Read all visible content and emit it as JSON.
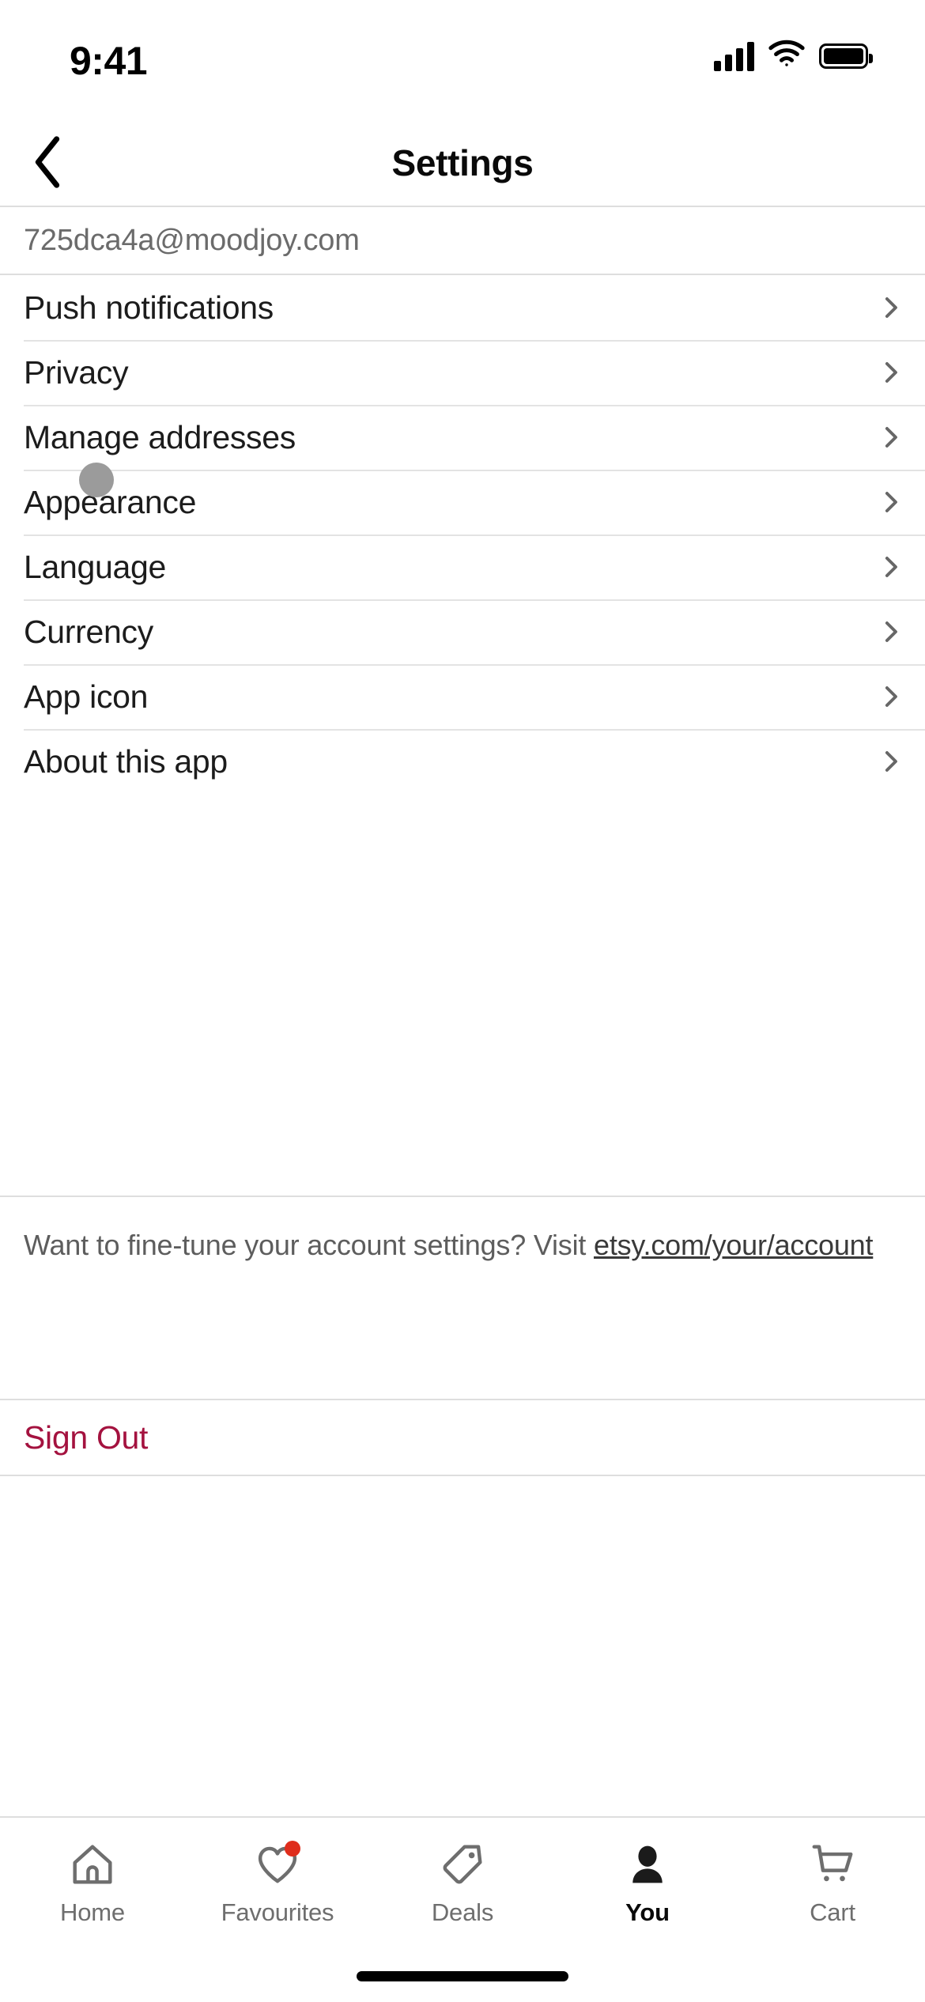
{
  "status_bar": {
    "time": "9:41",
    "icons": [
      "cellular-signal-icon",
      "wifi-icon",
      "battery-icon"
    ]
  },
  "nav_bar": {
    "back_icon": "chevron-left-icon",
    "title": "Settings"
  },
  "account": {
    "email": "725dca4a@moodjoy.com"
  },
  "settings_list": {
    "chevron_icon": "chevron-right-icon",
    "items": [
      {
        "label": "Push notifications"
      },
      {
        "label": "Privacy"
      },
      {
        "label": "Manage addresses"
      },
      {
        "label": "Appearance"
      },
      {
        "label": "Language"
      },
      {
        "label": "Currency"
      },
      {
        "label": "App icon"
      },
      {
        "label": "About this app"
      }
    ]
  },
  "footer_note": {
    "text": "Want to fine-tune your account settings? Visit ",
    "link_text": "etsy.com/your/account"
  },
  "sign_out": {
    "label": "Sign Out",
    "color": "#a4123f"
  },
  "touch_indicator": {
    "color": "#9b9b9b"
  },
  "tab_bar": {
    "tabs": [
      {
        "label": "Home",
        "icon": "home-icon",
        "active": false,
        "badge": false
      },
      {
        "label": "Favourites",
        "icon": "heart-icon",
        "active": false,
        "badge": true
      },
      {
        "label": "Deals",
        "icon": "tag-icon",
        "active": false,
        "badge": false
      },
      {
        "label": "You",
        "icon": "person-icon",
        "active": true,
        "badge": false
      },
      {
        "label": "Cart",
        "icon": "cart-icon",
        "active": false,
        "badge": false
      }
    ],
    "badge_color": "#df2d1c",
    "active_color": "#0a0a0a",
    "inactive_color": "#6e6e6e"
  }
}
